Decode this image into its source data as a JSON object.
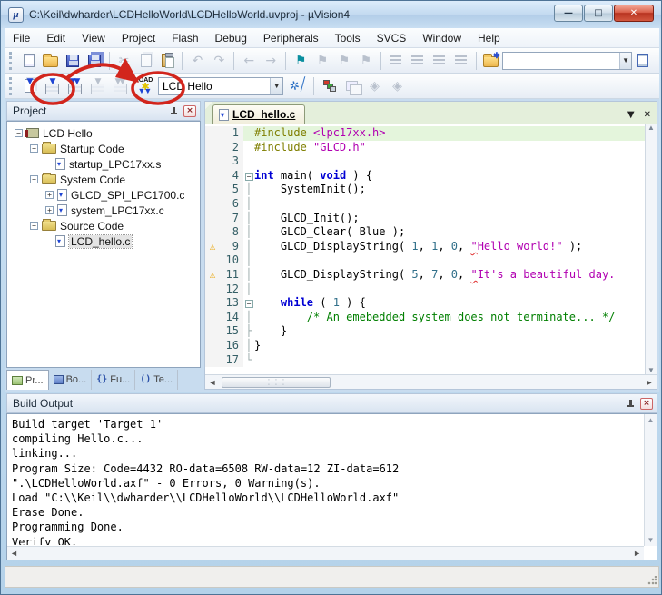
{
  "window": {
    "title": "C:\\Keil\\dwharder\\LCDHelloWorld\\LCDHelloWorld.uvproj - µVision4",
    "controls": [
      {
        "name": "minimize-button",
        "glyph": "▬"
      },
      {
        "name": "maximize-button",
        "glyph": "▣"
      },
      {
        "name": "close-button",
        "glyph": "✕"
      }
    ]
  },
  "menu": {
    "items": [
      "File",
      "Edit",
      "View",
      "Project",
      "Flash",
      "Debug",
      "Peripherals",
      "Tools",
      "SVCS",
      "Window",
      "Help"
    ]
  },
  "toolbar1": {
    "buttons": [
      {
        "name": "new-file-button",
        "icon": "new-file-icon",
        "glyph": "new",
        "enabled": true
      },
      {
        "name": "open-file-button",
        "icon": "open-folder-icon",
        "glyph": "open",
        "enabled": true
      },
      {
        "name": "save-button",
        "icon": "floppy-icon",
        "glyph": "save",
        "enabled": true
      },
      {
        "name": "save-all-button",
        "icon": "floppy-stack-icon",
        "glyph": "save-all",
        "enabled": true
      },
      {
        "sep": true
      },
      {
        "name": "cut-button",
        "icon": "scissors-icon",
        "glyph": "cut",
        "enabled": false
      },
      {
        "name": "copy-button",
        "icon": "copy-icon",
        "glyph": "copy",
        "enabled": false
      },
      {
        "name": "paste-button",
        "icon": "clipboard-icon",
        "glyph": "paste",
        "enabled": true
      },
      {
        "sep": true
      },
      {
        "name": "undo-button",
        "icon": "undo-icon",
        "glyph": "undo",
        "enabled": false
      },
      {
        "name": "redo-button",
        "icon": "redo-icon",
        "glyph": "redo",
        "enabled": false
      },
      {
        "sep": true
      },
      {
        "name": "navigate-back-button",
        "icon": "arrow-left-icon",
        "glyph": "back",
        "enabled": false
      },
      {
        "name": "navigate-forward-button",
        "icon": "arrow-right-icon",
        "glyph": "forward",
        "enabled": false
      },
      {
        "sep": true
      },
      {
        "name": "insert-bookmark-button",
        "icon": "flag-icon",
        "glyph": "flag",
        "enabled": true
      },
      {
        "name": "previous-bookmark-button",
        "icon": "flag-prev-icon",
        "glyph": "flag-gray",
        "enabled": false
      },
      {
        "name": "next-bookmark-button",
        "icon": "flag-next-icon",
        "glyph": "flag-gray",
        "enabled": false
      },
      {
        "name": "clear-bookmarks-button",
        "icon": "flag-clear-icon",
        "glyph": "flag-gray",
        "enabled": false
      },
      {
        "sep": true
      },
      {
        "name": "indent-button",
        "icon": "indent-icon",
        "glyph": "lines",
        "enabled": false
      },
      {
        "name": "unindent-button",
        "icon": "unindent-icon",
        "glyph": "lines",
        "enabled": false
      },
      {
        "name": "comment-button",
        "icon": "comment-icon",
        "glyph": "lines",
        "enabled": false
      },
      {
        "name": "uncomment-button",
        "icon": "uncomment-icon",
        "glyph": "lines",
        "enabled": false
      },
      {
        "sep": true
      },
      {
        "name": "find-in-files-button",
        "icon": "find-in-files-icon",
        "glyph": "findfiles",
        "enabled": true
      }
    ],
    "search_combo": {
      "value": "",
      "placeholder": ""
    },
    "right_button": {
      "name": "find-button",
      "icon": "find-document-icon"
    }
  },
  "toolbar2": {
    "buttons": [
      {
        "name": "translate-button",
        "icon": "translate-icon",
        "glyph": "translate",
        "enabled": true
      },
      {
        "name": "build-button",
        "icon": "build-icon",
        "glyph": "build",
        "enabled": true
      },
      {
        "name": "rebuild-button",
        "icon": "rebuild-icon",
        "glyph": "rebuild",
        "enabled": true
      },
      {
        "name": "batch-build-button",
        "icon": "batch-build-icon",
        "glyph": "build-gray",
        "enabled": false
      },
      {
        "name": "stop-build-button",
        "icon": "stop-build-icon",
        "glyph": "rebuild-gray",
        "enabled": false
      },
      {
        "name": "load-button",
        "icon": "load-icon",
        "glyph": "load",
        "enabled": true
      }
    ],
    "target_select": "LCD Hello",
    "after_buttons": [
      {
        "name": "target-options-button",
        "icon": "wizard-icon",
        "glyph": "wizard",
        "enabled": true
      },
      {
        "sep": true
      },
      {
        "name": "manage-components-button",
        "icon": "components-icon",
        "glyph": "components",
        "enabled": true
      },
      {
        "name": "file-extensions-button",
        "icon": "windows-cascade-icon",
        "glyph": "tworect",
        "enabled": false
      },
      {
        "name": "multi-project-button",
        "icon": "diamond-icon",
        "glyph": "diamond",
        "enabled": false
      },
      {
        "name": "workspace-button",
        "icon": "diamond2-icon",
        "glyph": "diamond",
        "enabled": false
      }
    ]
  },
  "annotation": {
    "color": "#d2251c",
    "note": "red circles around Build and LOAD buttons joined by arrow"
  },
  "project_panel": {
    "title": "Project",
    "tree": [
      {
        "level": 0,
        "label": "LCD Hello",
        "icon": "target-icon",
        "expander": "minus",
        "selected": false
      },
      {
        "level": 1,
        "label": "Startup Code",
        "icon": "folder-icon",
        "expander": "minus",
        "selected": false
      },
      {
        "level": 2,
        "label": "startup_LPC17xx.s",
        "icon": "file-icon",
        "expander": "none",
        "selected": false
      },
      {
        "level": 1,
        "label": "System Code",
        "icon": "folder-icon",
        "expander": "minus",
        "selected": false
      },
      {
        "level": 2,
        "label": "GLCD_SPI_LPC1700.c",
        "icon": "file-icon",
        "expander": "plus",
        "selected": false
      },
      {
        "level": 2,
        "label": "system_LPC17xx.c",
        "icon": "file-icon",
        "expander": "plus",
        "selected": false
      },
      {
        "level": 1,
        "label": "Source Code",
        "icon": "folder-icon",
        "expander": "minus",
        "selected": false
      },
      {
        "level": 2,
        "label": "LCD_hello.c",
        "icon": "file-icon",
        "expander": "none",
        "selected": true
      }
    ],
    "tabs": [
      {
        "label": "Pr...",
        "icon": "project-tab-icon",
        "active": true
      },
      {
        "label": "Bo...",
        "icon": "books-tab-icon",
        "active": false
      },
      {
        "label": "Fu...",
        "icon": "functions-tab-icon",
        "icon_text": "{}",
        "active": false
      },
      {
        "label": "Te...",
        "icon": "templates-tab-icon",
        "icon_text": "()",
        "active": false
      }
    ]
  },
  "editor": {
    "tab_label": "LCD_hello.c",
    "lines": [
      {
        "n": 1,
        "warn": false,
        "fold": "",
        "hl": true,
        "segs": [
          [
            "pp",
            "#include "
          ],
          [
            "s",
            "<lpc17xx.h>"
          ]
        ]
      },
      {
        "n": 2,
        "warn": false,
        "fold": "",
        "hl": false,
        "segs": [
          [
            "pp",
            "#include "
          ],
          [
            "s",
            "\"GLCD.h\""
          ]
        ]
      },
      {
        "n": 3,
        "warn": false,
        "fold": "",
        "hl": false,
        "segs": []
      },
      {
        "n": 4,
        "warn": false,
        "fold": "box",
        "hl": false,
        "segs": [
          [
            "k",
            "int"
          ],
          [
            "p",
            " main( "
          ],
          [
            "k",
            "void"
          ],
          [
            "p",
            " ) {"
          ]
        ]
      },
      {
        "n": 5,
        "warn": false,
        "fold": "line",
        "hl": false,
        "segs": [
          [
            "p",
            "    SystemInit();"
          ]
        ]
      },
      {
        "n": 6,
        "warn": false,
        "fold": "line",
        "hl": false,
        "segs": []
      },
      {
        "n": 7,
        "warn": false,
        "fold": "line",
        "hl": false,
        "segs": [
          [
            "p",
            "    GLCD_Init();"
          ]
        ]
      },
      {
        "n": 8,
        "warn": false,
        "fold": "line",
        "hl": false,
        "segs": [
          [
            "p",
            "    GLCD_Clear( Blue );"
          ]
        ]
      },
      {
        "n": 9,
        "warn": true,
        "fold": "line",
        "hl": false,
        "segs": [
          [
            "p",
            "    GLCD_DisplayString( "
          ],
          [
            "n",
            "1"
          ],
          [
            "p",
            ", "
          ],
          [
            "n",
            "1"
          ],
          [
            "p",
            ", "
          ],
          [
            "n",
            "0"
          ],
          [
            "p",
            ", "
          ],
          [
            "q",
            "\""
          ],
          [
            "s",
            "Hello world!\""
          ],
          [
            "p",
            " );"
          ]
        ]
      },
      {
        "n": 10,
        "warn": false,
        "fold": "line",
        "hl": false,
        "segs": []
      },
      {
        "n": 11,
        "warn": true,
        "fold": "line",
        "hl": false,
        "segs": [
          [
            "p",
            "    GLCD_DisplayString( "
          ],
          [
            "n",
            "5"
          ],
          [
            "p",
            ", "
          ],
          [
            "n",
            "7"
          ],
          [
            "p",
            ", "
          ],
          [
            "n",
            "0"
          ],
          [
            "p",
            ", "
          ],
          [
            "q",
            "\""
          ],
          [
            "s",
            "It's a beautiful day."
          ]
        ]
      },
      {
        "n": 12,
        "warn": false,
        "fold": "line",
        "hl": false,
        "segs": []
      },
      {
        "n": 13,
        "warn": false,
        "fold": "box",
        "hl": false,
        "segs": [
          [
            "p",
            "    "
          ],
          [
            "k",
            "while"
          ],
          [
            "p",
            " ( "
          ],
          [
            "n",
            "1"
          ],
          [
            "p",
            " ) {"
          ]
        ]
      },
      {
        "n": 14,
        "warn": false,
        "fold": "line",
        "hl": false,
        "segs": [
          [
            "c",
            "        /* An emebedded system does not terminate... */"
          ]
        ]
      },
      {
        "n": 15,
        "warn": false,
        "fold": "tee",
        "hl": false,
        "segs": [
          [
            "p",
            "    }"
          ]
        ]
      },
      {
        "n": 16,
        "warn": false,
        "fold": "line",
        "hl": false,
        "segs": [
          [
            "p",
            "}"
          ]
        ]
      },
      {
        "n": 17,
        "warn": false,
        "fold": "end",
        "hl": false,
        "segs": []
      }
    ]
  },
  "build_output": {
    "title": "Build Output",
    "lines": [
      "Build target 'Target 1'",
      "compiling Hello.c...",
      "linking...",
      "Program Size: Code=4432 RO-data=6508 RW-data=12 ZI-data=612",
      "\".\\LCDHelloWorld.axf\" - 0 Errors, 0 Warning(s).",
      "Load \"C:\\\\Keil\\\\dwharder\\\\LCDHelloWorld\\\\LCDHelloWorld.axf\"",
      "Erase Done.",
      "Programming Done.",
      "Verify OK."
    ]
  },
  "status_bar": {
    "text": ""
  }
}
